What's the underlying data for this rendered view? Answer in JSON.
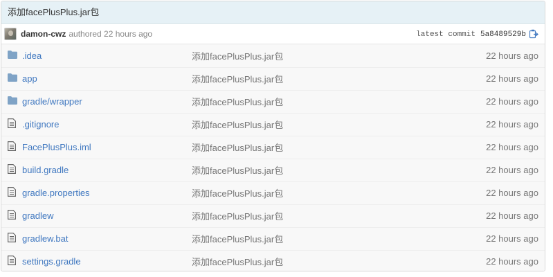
{
  "commit": {
    "message": "添加facePlusPlus.jar包",
    "author": "damon-cwz",
    "authored_text": "authored 22 hours ago",
    "latest_label": "latest commit",
    "sha": "5a8489529b"
  },
  "files": [
    {
      "name": ".idea",
      "type": "folder",
      "message": "添加facePlusPlus.jar包",
      "age": "22 hours ago"
    },
    {
      "name": "app",
      "type": "folder",
      "message": "添加facePlusPlus.jar包",
      "age": "22 hours ago"
    },
    {
      "name": "gradle/wrapper",
      "type": "folder",
      "message": "添加facePlusPlus.jar包",
      "age": "22 hours ago"
    },
    {
      "name": ".gitignore",
      "type": "file",
      "message": "添加facePlusPlus.jar包",
      "age": "22 hours ago"
    },
    {
      "name": "FacePlusPlus.iml",
      "type": "file",
      "message": "添加facePlusPlus.jar包",
      "age": "22 hours ago"
    },
    {
      "name": "build.gradle",
      "type": "file",
      "message": "添加facePlusPlus.jar包",
      "age": "22 hours ago"
    },
    {
      "name": "gradle.properties",
      "type": "file",
      "message": "添加facePlusPlus.jar包",
      "age": "22 hours ago"
    },
    {
      "name": "gradlew",
      "type": "file",
      "message": "添加facePlusPlus.jar包",
      "age": "22 hours ago"
    },
    {
      "name": "gradlew.bat",
      "type": "file",
      "message": "添加facePlusPlus.jar包",
      "age": "22 hours ago"
    },
    {
      "name": "settings.gradle",
      "type": "file",
      "message": "添加facePlusPlus.jar包",
      "age": "22 hours ago"
    }
  ],
  "colors": {
    "link": "#4078c0",
    "folder_icon": "#7fa3c6",
    "file_icon": "#666666",
    "header_bg": "#e6f1f6"
  }
}
